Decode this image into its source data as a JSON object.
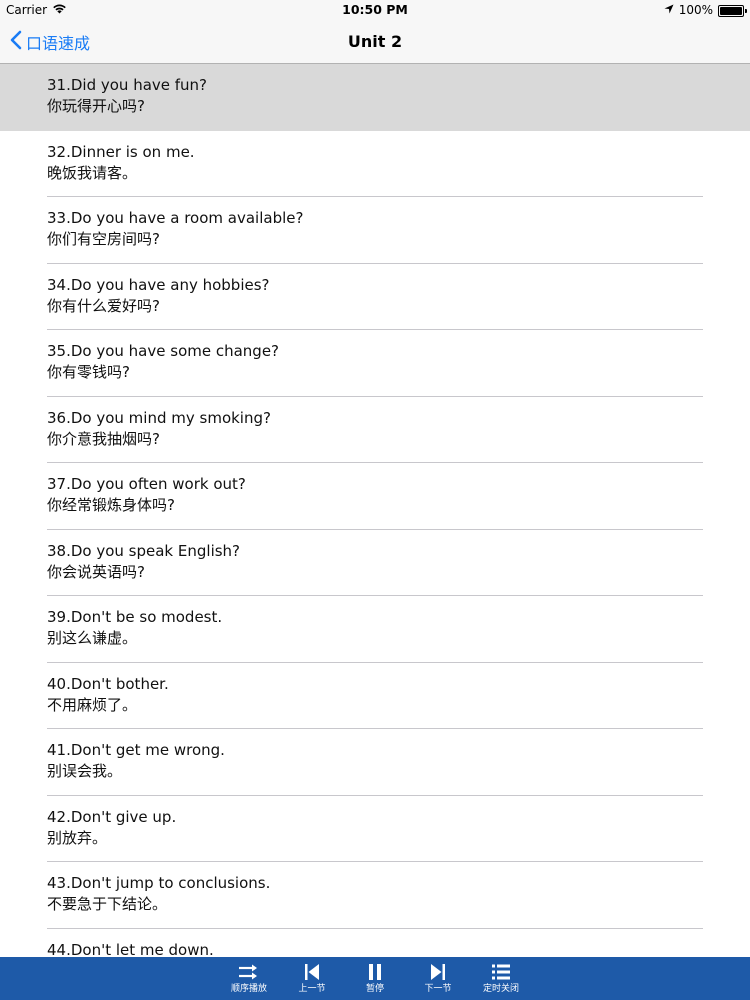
{
  "status_bar": {
    "carrier": "Carrier",
    "time": "10:50 PM",
    "battery": "100%"
  },
  "nav": {
    "back_label": "口语速成",
    "title": "Unit 2"
  },
  "items": [
    {
      "en": "31.Did you have fun?",
      "zh": "你玩得开心吗?"
    },
    {
      "en": "32.Dinner is on me.",
      "zh": "晚饭我请客。"
    },
    {
      "en": "33.Do you have a room available?",
      "zh": "你们有空房间吗?"
    },
    {
      "en": "34.Do you have any hobbies?",
      "zh": "你有什么爱好吗?"
    },
    {
      "en": "35.Do you have some change?",
      "zh": "你有零钱吗?"
    },
    {
      "en": "36.Do you mind my smoking?",
      "zh": "你介意我抽烟吗?"
    },
    {
      "en": "37.Do you often work out?",
      "zh": "你经常锻炼身体吗?"
    },
    {
      "en": "38.Do you speak English?",
      "zh": "你会说英语吗?"
    },
    {
      "en": "39.Don't be so modest.",
      "zh": "别这么谦虚。"
    },
    {
      "en": "40.Don't bother.",
      "zh": "不用麻烦了。"
    },
    {
      "en": "41.Don't get me wrong.",
      "zh": "别误会我。"
    },
    {
      "en": "42.Don't give up.",
      "zh": "别放弃。"
    },
    {
      "en": "43.Don't jump to conclusions.",
      "zh": "不要急于下结论。"
    },
    {
      "en": "44.Don't let me down.",
      "zh": ""
    }
  ],
  "toolbar": {
    "sequential": "顺序播放",
    "previous": "上一节",
    "pause": "暂停",
    "next": "下一节",
    "timer": "定时关闭"
  },
  "colors": {
    "accent": "#1a7cf5",
    "toolbar_bg": "#1e5aa8",
    "selected_row": "#d9d9d9"
  }
}
